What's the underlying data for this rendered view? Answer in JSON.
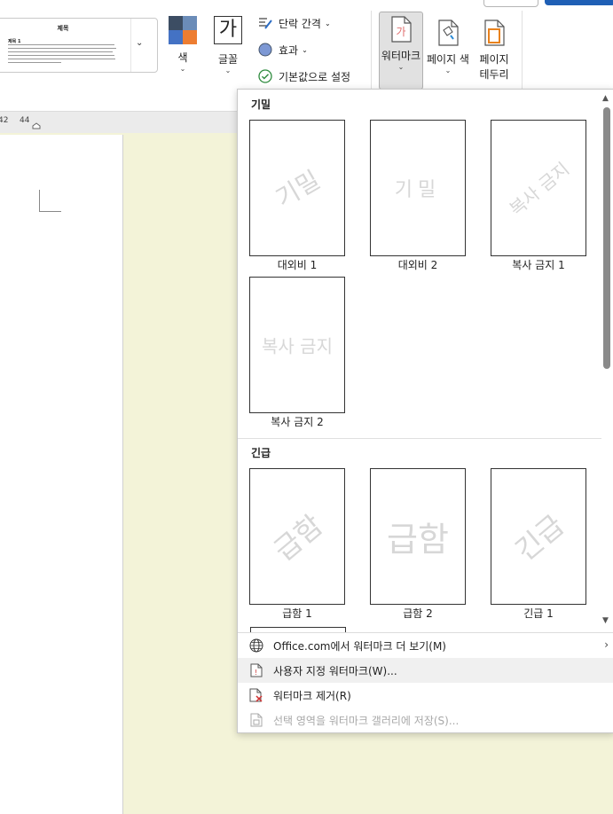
{
  "ribbon": {
    "theme_preview": {
      "title": "제목",
      "heading": "제목 1"
    },
    "colors": {
      "label": "색"
    },
    "fonts": {
      "label": "글꼴",
      "glyph": "가"
    },
    "paragraph_spacing": {
      "label": "단락 간격"
    },
    "effects": {
      "label": "효과"
    },
    "set_as_default": {
      "label": "기본값으로 설정"
    },
    "watermark": {
      "label": "워터마크"
    },
    "page_color": {
      "label": "페이지 색"
    },
    "page_borders": {
      "label_line1": "페이지",
      "label_line2": "테두리"
    },
    "theme_colors": [
      "#3c4d63",
      "#6b8cb8",
      "#4472c4",
      "#ed7d31"
    ]
  },
  "ruler": {
    "left_label": "42",
    "right_label": "44"
  },
  "gallery": {
    "sections": [
      {
        "title": "기밀",
        "items": [
          {
            "label": "대외비 1",
            "watermark": "기밀"
          },
          {
            "label": "대외비 2",
            "watermark": "기밀"
          },
          {
            "label": "복사 금지 1",
            "watermark": "복사 금지"
          },
          {
            "label": "복사 금지 2",
            "watermark": "복사 금지"
          }
        ]
      },
      {
        "title": "긴급",
        "items": [
          {
            "label": "급함 1",
            "watermark": "급함"
          },
          {
            "label": "급함 2",
            "watermark": "급함"
          },
          {
            "label": "긴급 1",
            "watermark": "긴급"
          }
        ]
      }
    ],
    "menu": [
      {
        "label": "Office.com에서 워터마크 더 보기(M)",
        "icon": "globe-icon",
        "has_submenu": true
      },
      {
        "label": "사용자 지정 워터마크(W)...",
        "icon": "custom-watermark-icon",
        "highlighted": true
      },
      {
        "label": "워터마크 제거(R)",
        "icon": "remove-watermark-icon"
      },
      {
        "label": "선택 영역을 워터마크 갤러리에 저장(S)...",
        "icon": "save-to-gallery-icon",
        "disabled": true
      }
    ]
  }
}
